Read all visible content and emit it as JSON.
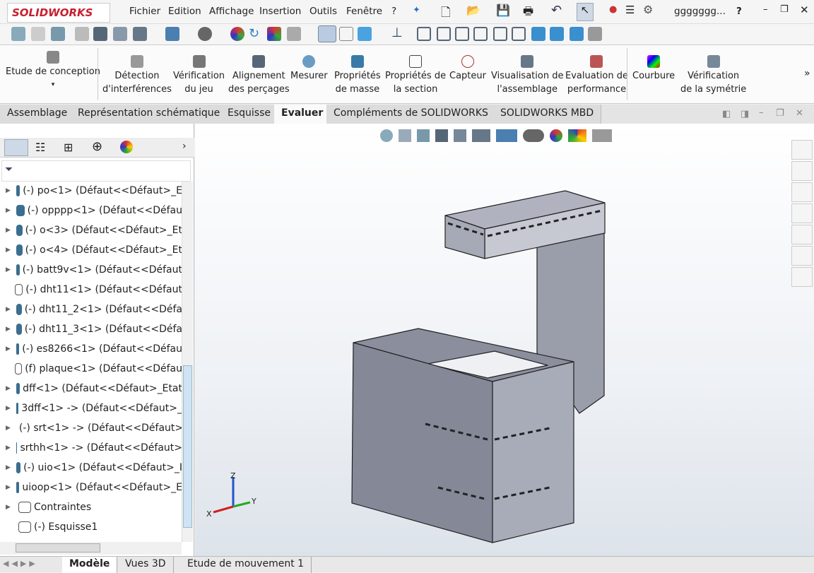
{
  "app": {
    "logo": "SOLIDWORKS",
    "user": "ggggggg...",
    "help": "?"
  },
  "menu": [
    "Fichier",
    "Edition",
    "Affichage",
    "Insertion",
    "Outils",
    "Fenêtre",
    "?"
  ],
  "ribbon": [
    {
      "label1": "Etude de conception",
      "label2": ""
    },
    {
      "label1": "Détection",
      "label2": "d'interférences"
    },
    {
      "label1": "Vérification",
      "label2": "du jeu"
    },
    {
      "label1": "Alignement",
      "label2": "des perçages"
    },
    {
      "label1": "Mesurer",
      "label2": ""
    },
    {
      "label1": "Propriétés",
      "label2": "de masse"
    },
    {
      "label1": "Propriétés de",
      "label2": "la section"
    },
    {
      "label1": "Capteur",
      "label2": ""
    },
    {
      "label1": "Visualisation de",
      "label2": "l'assemblage"
    },
    {
      "label1": "Evaluation de",
      "label2": "performance"
    },
    {
      "label1": "Courbure",
      "label2": ""
    },
    {
      "label1": "Vérification",
      "label2": "de la symétrie"
    }
  ],
  "tabs": [
    "Assemblage",
    "Représentation schématique",
    "Esquisse",
    "Evaluer",
    "Compléments de SOLIDWORKS",
    "SOLIDWORKS MBD"
  ],
  "active_tab": "Evaluer",
  "tree": [
    {
      "text": "(-) po<1> (Défaut<<Défaut>_E",
      "icon": "part"
    },
    {
      "text": "(-) opppp<1> (Défaut<<Défau",
      "icon": "part"
    },
    {
      "text": "(-) o<3> (Défaut<<Défaut>_Et",
      "icon": "part"
    },
    {
      "text": "(-) o<4> (Défaut<<Défaut>_Et",
      "icon": "part"
    },
    {
      "text": "(-) batt9v<1> (Défaut<<Défaut",
      "icon": "part"
    },
    {
      "text": "(-) dht11<1> (Défaut<<Défaut",
      "icon": "part-outline"
    },
    {
      "text": "(-) dht11_2<1> (Défaut<<Défa",
      "icon": "part"
    },
    {
      "text": "(-) dht11_3<1> (Défaut<<Défa",
      "icon": "part"
    },
    {
      "text": "(-) es8266<1> (Défaut<<Défau",
      "icon": "part"
    },
    {
      "text": "(f) plaque<1> (Défaut<<Défau",
      "icon": "part-outline"
    },
    {
      "text": "dff<1> (Défaut<<Défaut>_Etat",
      "icon": "part"
    },
    {
      "text": "3dff<1> -> (Défaut<<Défaut>_",
      "icon": "part"
    },
    {
      "text": "(-) srt<1> -> (Défaut<<Défaut>",
      "icon": "part"
    },
    {
      "text": "srthh<1> -> (Défaut<<Défaut>",
      "icon": "part"
    },
    {
      "text": "(-) uio<1> (Défaut<<Défaut>_I",
      "icon": "part"
    },
    {
      "text": "uioop<1> (Défaut<<Défaut>_E",
      "icon": "part"
    },
    {
      "text": "Contraintes",
      "icon": "mates"
    },
    {
      "text": "(-) Esquisse1",
      "icon": "sketch"
    }
  ],
  "bottom_tabs": [
    "Modèle",
    "Vues 3D",
    "Etude de mouvement 1"
  ],
  "active_bottom_tab": "Modèle",
  "triad": {
    "x": "X",
    "y": "Y",
    "z": "Z"
  },
  "colors": {
    "part": "#3c6e8f",
    "model": "#8c8fa0",
    "accent": "#c8202f"
  }
}
